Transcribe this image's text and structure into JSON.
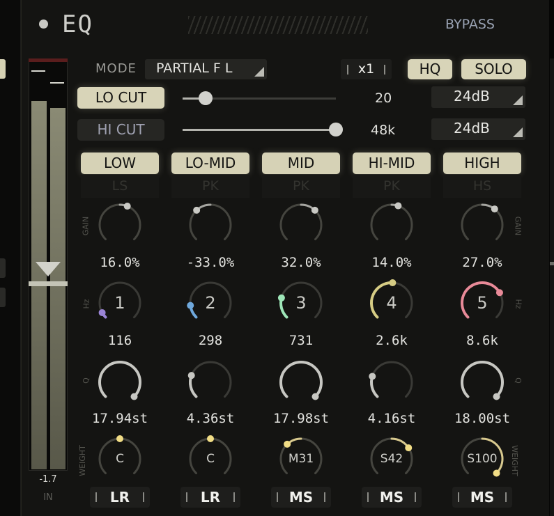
{
  "header": {
    "title": "EQ",
    "bypass_label": "BYPASS"
  },
  "meter": {
    "value": "-1.7",
    "label": "IN"
  },
  "mode": {
    "label": "MODE",
    "value": "PARTIAL F L"
  },
  "oversample": "x1",
  "toggles": {
    "hq": "HQ",
    "solo": "SOLO"
  },
  "lo_cut": {
    "label": "LO CUT",
    "value": "20",
    "slope": "24dB",
    "enabled": true,
    "position": 0.15
  },
  "hi_cut": {
    "label": "HI CUT",
    "value": "48k",
    "slope": "24dB",
    "enabled": false,
    "position": 1.0
  },
  "row_labels": {
    "gain": "GAIN",
    "hz": "Hz",
    "q": "Q",
    "weight": "WEIGHT"
  },
  "bands": [
    {
      "name": "LOW",
      "type": "LS",
      "gain": "16.0%",
      "gain_level": 0.58,
      "freq_num": "1",
      "freq": "116",
      "freq_level": 0.06,
      "q": "17.94st",
      "q_level": 1.0,
      "weight": "C",
      "weight_level": 0.5,
      "stereo": "LR",
      "color": "#9a84d6"
    },
    {
      "name": "LO-MID",
      "type": "PK",
      "gain": "-33.0%",
      "gain_level": 0.34,
      "freq_num": "2",
      "freq": "298",
      "freq_level": 0.14,
      "q": "4.36st",
      "q_level": 0.24,
      "weight": "C",
      "weight_level": 0.5,
      "stereo": "LR",
      "color": "#6fa8dc"
    },
    {
      "name": "MID",
      "type": "PK",
      "gain": "32.0%",
      "gain_level": 0.66,
      "freq_num": "3",
      "freq": "731",
      "freq_level": 0.22,
      "q": "17.98st",
      "q_level": 1.0,
      "weight": "M31",
      "weight_level": 0.34,
      "stereo": "MS",
      "color": "#9ee6b8"
    },
    {
      "name": "HI-MID",
      "type": "PK",
      "gain": "14.0%",
      "gain_level": 0.57,
      "freq_num": "4",
      "freq": "2.6k",
      "freq_level": 0.51,
      "q": "4.16st",
      "q_level": 0.23,
      "weight": "S42",
      "weight_level": 0.71,
      "stereo": "MS",
      "color": "#d6cc84"
    },
    {
      "name": "HIGH",
      "type": "HS",
      "gain": "27.0%",
      "gain_level": 0.64,
      "freq_num": "5",
      "freq": "8.6k",
      "freq_level": 0.72,
      "q": "18.00st",
      "q_level": 1.0,
      "weight": "S100",
      "weight_level": 1.0,
      "stereo": "MS",
      "color": "#e88a98"
    }
  ]
}
